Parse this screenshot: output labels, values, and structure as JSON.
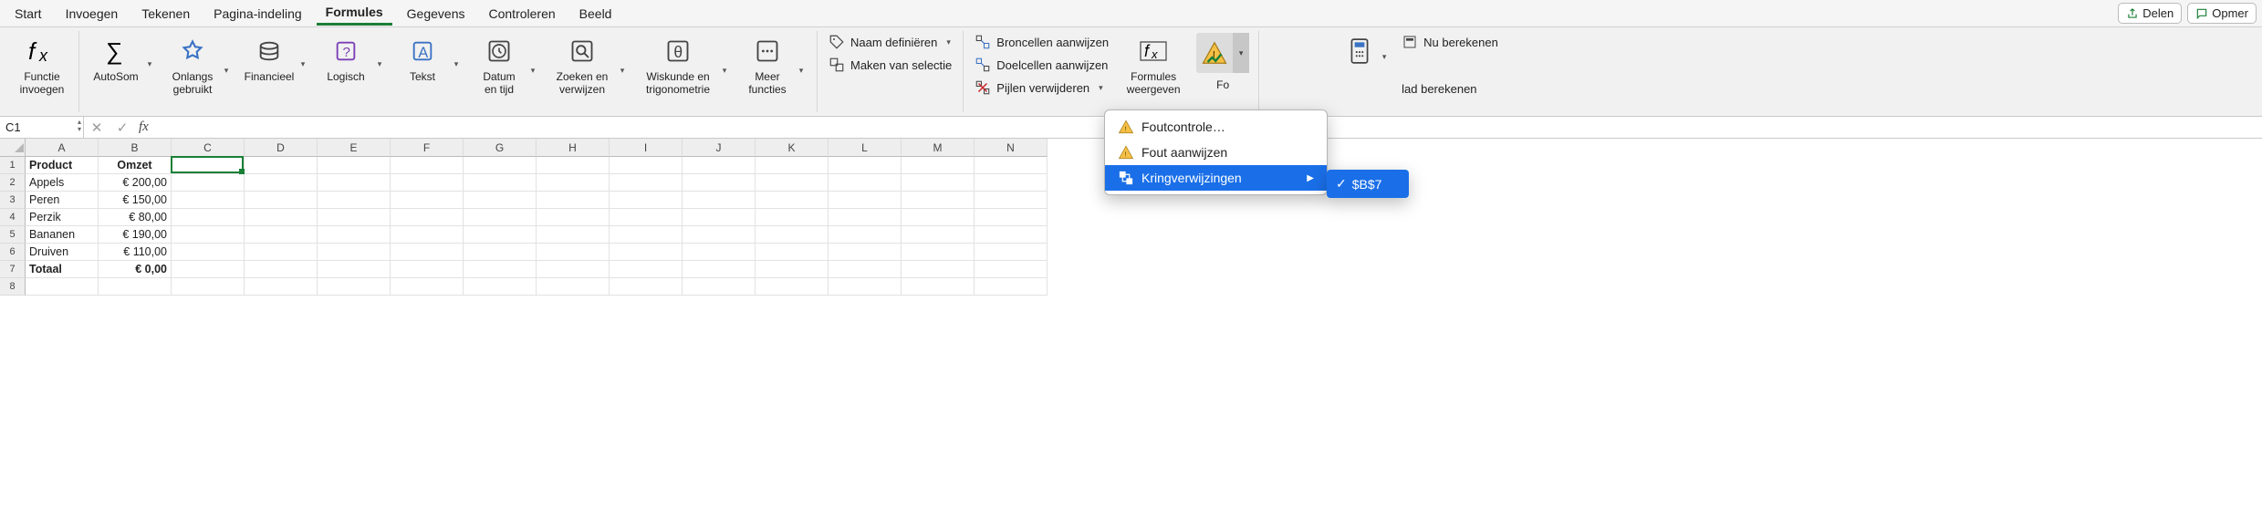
{
  "tabs": {
    "items": [
      "Start",
      "Invoegen",
      "Tekenen",
      "Pagina-indeling",
      "Formules",
      "Gegevens",
      "Controleren",
      "Beeld"
    ],
    "active_index": 4,
    "share": "Delen",
    "comments": "Opmer"
  },
  "ribbon": {
    "insert_function": "Functie\ninvoegen",
    "autosum": "AutoSom",
    "recent": "Onlangs\ngebruikt",
    "financial": "Financieel",
    "logical": "Logisch",
    "text": "Tekst",
    "datetime": "Datum\nen tijd",
    "lookup": "Zoeken en\nverwijzen",
    "math": "Wiskunde en\ntrigonometrie",
    "more": "Meer\nfuncties",
    "define_name": "Naam definiëren",
    "create_from_sel": "Maken van selectie",
    "trace_prec": "Broncellen aanwijzen",
    "trace_dep": "Doelcellen aanwijzen",
    "remove_arrows": "Pijlen verwijderen",
    "show_formulas": "Formules\nweergeven",
    "error_hidden_label": "Fo",
    "calc_now": "Nu berekenen",
    "calc_sheet": "lad berekenen"
  },
  "menu": {
    "error_check": "Foutcontrole…",
    "trace_error": "Fout aanwijzen",
    "circular": "Kringverwijzingen",
    "circular_ref": "$B$7"
  },
  "fbar": {
    "name_box": "C1",
    "formula": ""
  },
  "grid": {
    "columns": [
      "A",
      "B",
      "C",
      "D",
      "E",
      "F",
      "G",
      "H",
      "I",
      "J",
      "K",
      "L",
      "M",
      "N"
    ],
    "rows": [
      {
        "n": 1,
        "a": "Product",
        "b": "Omzet",
        "a_bold": true,
        "b_bold": true,
        "b_align": "center"
      },
      {
        "n": 2,
        "a": "Appels",
        "b": "€ 200,00"
      },
      {
        "n": 3,
        "a": "Peren",
        "b": "€ 150,00"
      },
      {
        "n": 4,
        "a": "Perzik",
        "b": "€ 80,00"
      },
      {
        "n": 5,
        "a": "Bananen",
        "b": "€ 190,00"
      },
      {
        "n": 6,
        "a": "Druiven",
        "b": "€ 110,00"
      },
      {
        "n": 7,
        "a": "Totaal",
        "b": "€ 0,00",
        "a_bold": true,
        "b_bold": true
      },
      {
        "n": 8,
        "a": "",
        "b": ""
      }
    ],
    "active_cell": "C1"
  }
}
